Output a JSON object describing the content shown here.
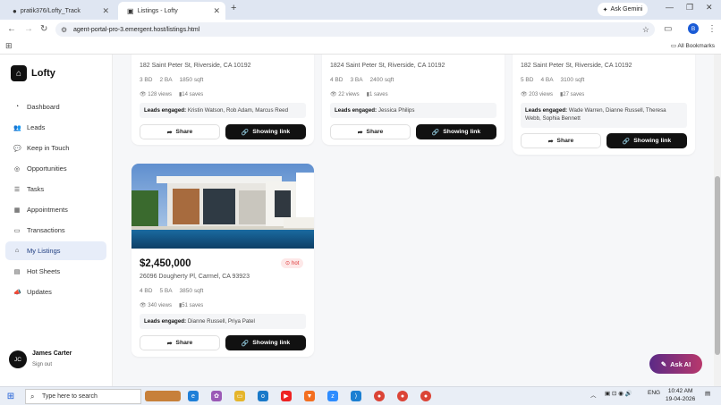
{
  "browser": {
    "tabs": [
      {
        "title": "pratik376/Lofty_Track",
        "active": false
      },
      {
        "title": "Listings - Lofty",
        "active": true
      }
    ],
    "gemini_label": "Ask Gemini",
    "url": "agent-portal-pro-3.emergent.host/listings.html",
    "all_bookmarks": "All Bookmarks"
  },
  "sidebar": {
    "brand": "Lofty",
    "items": [
      {
        "label": "Dashboard",
        "icon": "dashboard-icon",
        "glyph": "◔"
      },
      {
        "label": "Leads",
        "icon": "leads-icon",
        "glyph": "👥"
      },
      {
        "label": "Keep in Touch",
        "icon": "chat-icon",
        "glyph": "💬"
      },
      {
        "label": "Opportunities",
        "icon": "target-icon",
        "glyph": "◎"
      },
      {
        "label": "Tasks",
        "icon": "tasks-icon",
        "glyph": "☰"
      },
      {
        "label": "Appointments",
        "icon": "calendar-icon",
        "glyph": "▦"
      },
      {
        "label": "Transactions",
        "icon": "transactions-icon",
        "glyph": "▭"
      },
      {
        "label": "My Listings",
        "icon": "home-icon",
        "glyph": "⌂"
      },
      {
        "label": "Hot Sheets",
        "icon": "sheets-icon",
        "glyph": "▤"
      },
      {
        "label": "Updates",
        "icon": "megaphone-icon",
        "glyph": "📣"
      }
    ],
    "active_index": 7,
    "user": {
      "initials": "JC",
      "name": "James Carter",
      "signout": "Sign out"
    }
  },
  "listings": [
    {
      "address": "182 Saint Peter St, Riverside, CA 10192",
      "beds": "3 BD",
      "baths": "2 BA",
      "sqft": "1850 sqft",
      "views": "128 views",
      "saves": "14 saves",
      "leads_label": "Leads engaged:",
      "leads": "Kristin Watson, Rob Adam, Marcus Reed",
      "share": "Share",
      "showing": "Showing link"
    },
    {
      "address": "1824 Saint Peter St, Riverside, CA 10192",
      "beds": "4 BD",
      "baths": "3 BA",
      "sqft": "2400 sqft",
      "views": "22 views",
      "saves": "1 saves",
      "leads_label": "Leads engaged:",
      "leads": "Jessica Philips",
      "share": "Share",
      "showing": "Showing link"
    },
    {
      "address": "182 Saint Peter St, Riverside, CA 10192",
      "beds": "5 BD",
      "baths": "4 BA",
      "sqft": "3100 sqft",
      "views": "203 views",
      "saves": "27 saves",
      "leads_label": "Leads engaged:",
      "leads": "Wade Warren, Dianne Russell, Theresa Webb, Sophia Bennett",
      "share": "Share",
      "showing": "Showing link"
    },
    {
      "price": "$2,450,000",
      "badge": "hot",
      "address": "26096 Dougherty Pl, Carmel, CA 93923",
      "beds": "4 BD",
      "baths": "5 BA",
      "sqft": "3850 sqft",
      "views": "340 views",
      "saves": "51 saves",
      "leads_label": "Leads engaged:",
      "leads": "Dianne Russell, Priya Patel",
      "share": "Share",
      "showing": "Showing link"
    }
  ],
  "ask_ai": "Ask AI",
  "taskbar": {
    "search_placeholder": "Type here to search",
    "lang": "ENG",
    "time": "10:42 AM",
    "date": "19-04-2026"
  },
  "colors": {
    "accent": "#111111",
    "active_nav_bg": "#e7edf9",
    "hot_badge": "#dd3333"
  }
}
